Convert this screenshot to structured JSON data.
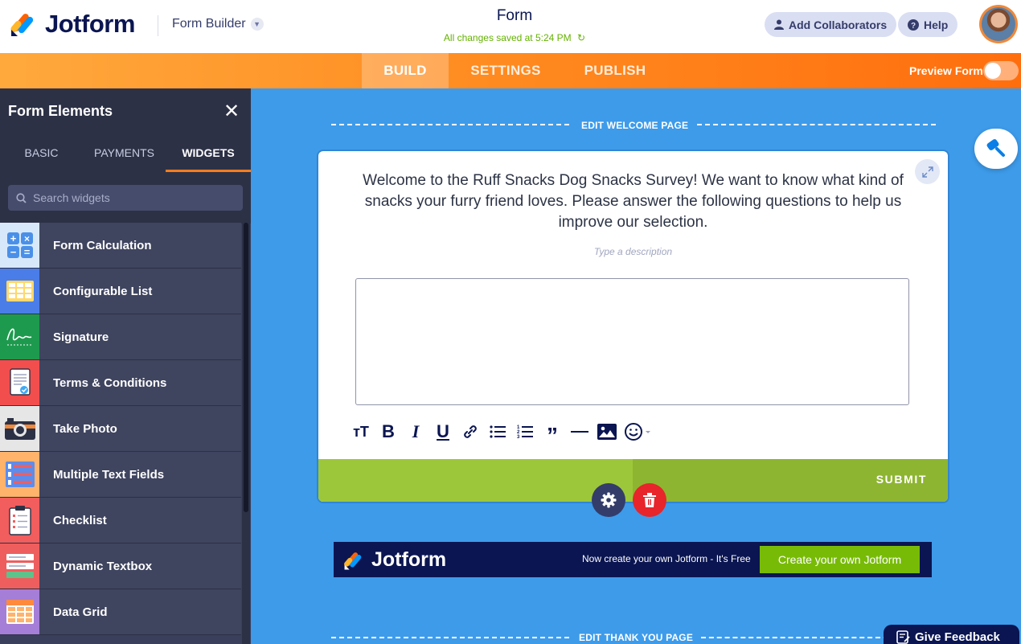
{
  "header": {
    "logo_text": "Jotform",
    "builder_label": "Form Builder",
    "form_title": "Form",
    "saved_status": "All changes saved at 5:24 PM",
    "add_collaborators": "Add Collaborators",
    "help": "Help"
  },
  "nav": {
    "tabs": [
      "BUILD",
      "SETTINGS",
      "PUBLISH"
    ],
    "active_tab": "BUILD",
    "preview_label": "Preview Form",
    "preview_on": false
  },
  "sidebar": {
    "title": "Form Elements",
    "tabs": [
      "BASIC",
      "PAYMENTS",
      "WIDGETS"
    ],
    "active_tab": "WIDGETS",
    "search_placeholder": "Search widgets",
    "items": [
      {
        "label": "Form Calculation",
        "icon": "calculator-icon",
        "color": "#6aa7ee"
      },
      {
        "label": "Configurable List",
        "icon": "grid-list-icon",
        "color": "#4a7de8"
      },
      {
        "label": "Signature",
        "icon": "signature-icon",
        "color": "#1e9a4e"
      },
      {
        "label": "Terms & Conditions",
        "icon": "document-check-icon",
        "color": "#f24e4e"
      },
      {
        "label": "Take Photo",
        "icon": "camera-icon",
        "color": "#e6e6e6"
      },
      {
        "label": "Multiple Text Fields",
        "icon": "text-fields-icon",
        "color": "#ffb36b"
      },
      {
        "label": "Checklist",
        "icon": "clipboard-icon",
        "color": "#f25d5d"
      },
      {
        "label": "Dynamic Textbox",
        "icon": "textbox-icon",
        "color": "#ee5e5e"
      },
      {
        "label": "Data Grid",
        "icon": "data-grid-icon",
        "color": "#a57ed8"
      }
    ]
  },
  "canvas": {
    "edit_welcome": "EDIT WELCOME PAGE",
    "edit_thankyou": "EDIT THANK YOU PAGE",
    "welcome_text": "Welcome to the Ruff Snacks Dog Snacks Survey! We want to know what kind of snacks your furry friend loves. Please answer the following questions to help us improve our selection.",
    "description_placeholder": "Type a description",
    "submit_label": "SUBMIT",
    "banner_logo": "Jotform",
    "banner_text": "Now create your own Jotform - It's Free",
    "banner_button": "Create your own Jotform"
  },
  "feedback_label": "Give Feedback",
  "colors": {
    "brand_navy": "#0a1551",
    "nav_orange": "#ff8a1f",
    "canvas_blue": "#3d9bea",
    "submit_green": "#9dc73a",
    "cta_green": "#78bb07",
    "delete_red": "#e7252b"
  }
}
